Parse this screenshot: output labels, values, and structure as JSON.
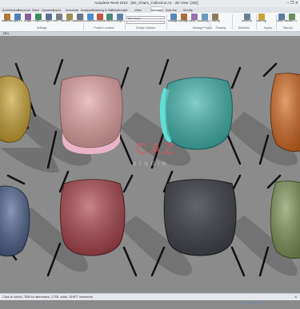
{
  "app": {
    "title": "Autodesk Revit 2018 - [3D_Chairs_Collection.rvt - 3D View: {3D}]",
    "window_controls": "–  ❐  ✕"
  },
  "tabs": [
    {
      "label": "Architecture"
    },
    {
      "label": "Structure"
    },
    {
      "label": "Steel"
    },
    {
      "label": "Systems"
    },
    {
      "label": "Insert"
    },
    {
      "label": "Annotate"
    },
    {
      "label": "Analyze"
    },
    {
      "label": "Massing & Site"
    },
    {
      "label": "Collaborate"
    },
    {
      "label": "View"
    },
    {
      "label": "Manage"
    },
    {
      "label": "Add-Ins"
    },
    {
      "label": "Modify"
    }
  ],
  "active_tab": "Manage",
  "ribbon": {
    "buttons": [
      {
        "label": "Materials",
        "icon": "materials-icon",
        "color": "#b07a3a"
      },
      {
        "label": "Object Styles",
        "icon": "object-styles-icon",
        "color": "#4d7fb8"
      },
      {
        "label": "Snaps",
        "icon": "snaps-icon",
        "color": "#8a5aa0"
      },
      {
        "label": "Project Info",
        "icon": "project-info-icon",
        "color": "#3e8a62"
      },
      {
        "label": "Project Parameters",
        "icon": "project-parameters-icon",
        "color": "#5a6f92"
      },
      {
        "label": "MEP Settings",
        "icon": "mep-settings-icon",
        "color": "#7a7f86"
      },
      {
        "label": "Panel Schedule Templates",
        "icon": "panel-schedule-icon",
        "color": "#9c8f55"
      },
      {
        "label": "Additional Settings",
        "icon": "additional-settings-icon",
        "color": "#6d7580"
      },
      {
        "label": "Location",
        "icon": "location-icon",
        "color": "#4f8ccf"
      },
      {
        "label": "Coordinates",
        "icon": "coordinates-icon",
        "color": "#c2553e"
      },
      {
        "label": "Position",
        "icon": "position-icon",
        "color": "#4a8a7a"
      },
      {
        "label": "Design Options",
        "icon": "design-options-icon",
        "color": "#6280a8"
      },
      {
        "label": "Manage Links",
        "icon": "manage-links-icon",
        "color": "#5788b6"
      },
      {
        "label": "Manage Images",
        "icon": "manage-images-icon",
        "color": "#a26e3f"
      },
      {
        "label": "Decal Types",
        "icon": "decal-types-icon",
        "color": "#9a6fb0"
      },
      {
        "label": "Starting View",
        "icon": "starting-view-icon",
        "color": "#6c9ac7"
      },
      {
        "label": "Phasing",
        "icon": "phasing-icon",
        "color": "#8c7a5a"
      },
      {
        "label": "Select by ID",
        "icon": "select-by-id-icon",
        "color": "#6e7f95"
      },
      {
        "label": "Warnings",
        "icon": "warnings-icon",
        "color": "#c9a236"
      },
      {
        "label": "Macro Manager",
        "icon": "macro-manager-icon",
        "color": "#5b7aa6"
      },
      {
        "label": "Macro Security",
        "icon": "macro-security-icon",
        "color": "#6a8c5a"
      }
    ],
    "combo": "Main Model",
    "panels": [
      {
        "label": "Settings"
      },
      {
        "label": "Project Location"
      },
      {
        "label": "Design Options"
      },
      {
        "label": "Manage Project"
      },
      {
        "label": "Phasing"
      },
      {
        "label": "Selection"
      },
      {
        "label": "Inquiry"
      },
      {
        "label": "Macros"
      }
    ]
  },
  "document": {
    "tab_label": "{3D}"
  },
  "watermark": {
    "text": "CAZ",
    "subtext": "studio"
  },
  "chairs": [
    {
      "name": "mustard-chair",
      "color": "#c9a233"
    },
    {
      "name": "pink-chair",
      "color": "#e2a2a2"
    },
    {
      "name": "teal-chair",
      "color": "#3fb4ac"
    },
    {
      "name": "orange-chair",
      "color": "#d46a22"
    },
    {
      "name": "blue-chair",
      "color": "#4a5f8a"
    },
    {
      "name": "red-chair",
      "color": "#a8434a"
    },
    {
      "name": "charcoal-chair",
      "color": "#3a3d44"
    },
    {
      "name": "olive-chair",
      "color": "#7f9457"
    }
  ],
  "status": {
    "text": "Click to select, TAB for alternates, CTRL adds, SHIFT unselects.",
    "zoom": ":0"
  }
}
